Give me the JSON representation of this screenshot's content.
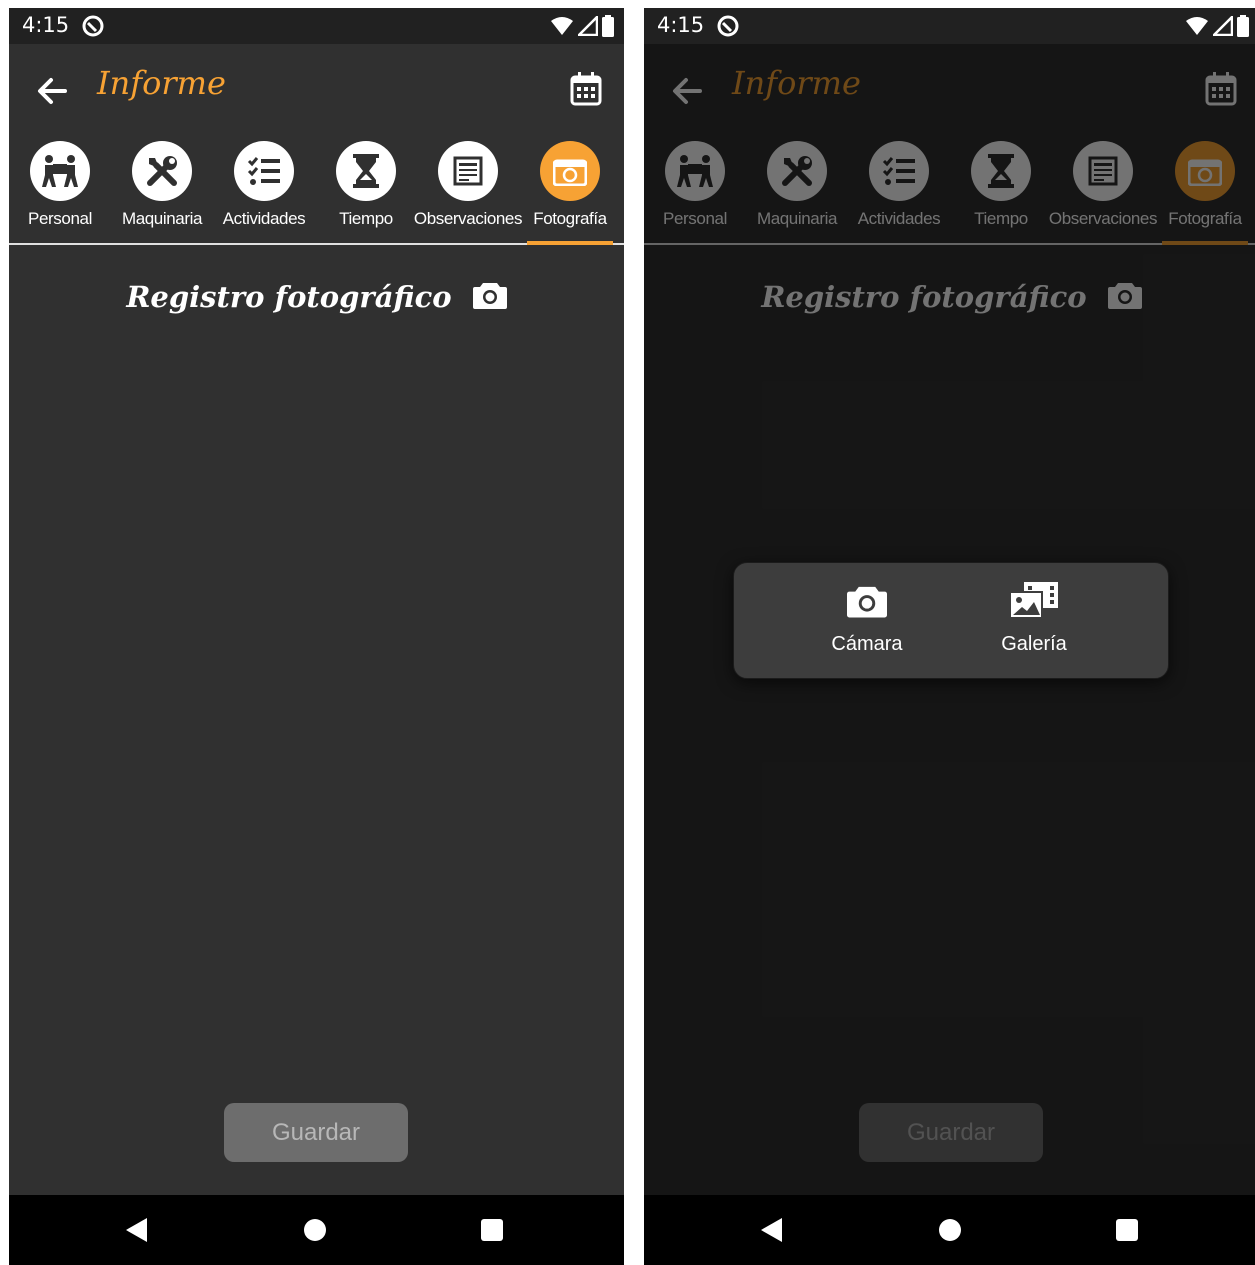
{
  "status": {
    "time": "4:15"
  },
  "appbar": {
    "title": "Informe"
  },
  "tabs": [
    {
      "label": "Personal",
      "icon": "people-carry-icon",
      "active": false
    },
    {
      "label": "Maquinaria",
      "icon": "tools-icon",
      "active": false
    },
    {
      "label": "Actividades",
      "icon": "tasks-icon",
      "active": false
    },
    {
      "label": "Tiempo",
      "icon": "hourglass-icon",
      "active": false
    },
    {
      "label": "Observaciones",
      "icon": "notes-icon",
      "active": false
    },
    {
      "label": "Fotografía",
      "icon": "camera-icon",
      "active": true
    }
  ],
  "section": {
    "title": "Registro fotográfico"
  },
  "save_button": {
    "label": "Guardar"
  },
  "dialog": {
    "camera_label": "Cámara",
    "gallery_label": "Galería"
  },
  "colors": {
    "accent": "#f7a234",
    "background": "#303030",
    "statusbar": "#212121",
    "dialog": "#3d3d3d"
  }
}
